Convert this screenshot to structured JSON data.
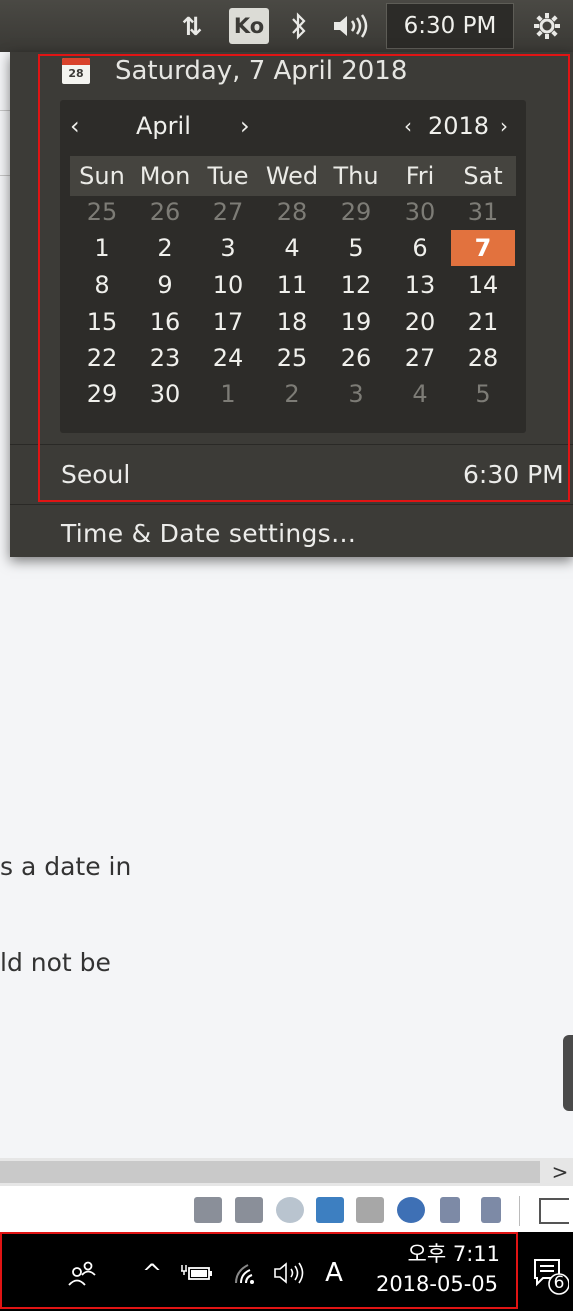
{
  "top_panel": {
    "network_icon": "network-updown-icon",
    "keyboard_lang": "Ko",
    "bluetooth_icon": "bluetooth-icon",
    "volume_icon": "volume-icon",
    "clock": "6:30 PM",
    "settings_icon": "gear-icon"
  },
  "datetime_menu": {
    "calendar_icon_day": "28",
    "header_date": "Saturday, 7 April 2018",
    "month_nav": {
      "prev": "‹",
      "month": "April",
      "next": "›"
    },
    "year_nav": {
      "prev": "‹",
      "year": "2018",
      "next": "›"
    },
    "weekdays": [
      "Sun",
      "Mon",
      "Tue",
      "Wed",
      "Thu",
      "Fri",
      "Sat"
    ],
    "weeks": [
      [
        "25",
        "26",
        "27",
        "28",
        "29",
        "30",
        "31"
      ],
      [
        "1",
        "2",
        "3",
        "4",
        "5",
        "6",
        "7"
      ],
      [
        "8",
        "9",
        "10",
        "11",
        "12",
        "13",
        "14"
      ],
      [
        "15",
        "16",
        "17",
        "18",
        "19",
        "20",
        "21"
      ],
      [
        "22",
        "23",
        "24",
        "25",
        "26",
        "27",
        "28"
      ],
      [
        "29",
        "30",
        "1",
        "2",
        "3",
        "4",
        "5"
      ]
    ],
    "selected_day": "7",
    "location": {
      "name": "Seoul",
      "time": "6:30 PM"
    },
    "settings_label": "Time & Date settings…"
  },
  "document": {
    "line1": "s a date in",
    "line2": "ld not be"
  },
  "scrollbar": {
    "right_arrow": ">"
  },
  "taskbar": {
    "people_icon": "people-icon",
    "show_hidden": "^",
    "battery_icon": "battery-icon",
    "wifi_icon": "wifi-icon",
    "volume_icon": "volume-icon",
    "input_lang": "A",
    "time": "오후 7:11",
    "date": "2018-05-05",
    "notification_count": "6"
  },
  "colors": {
    "panel_bg": "#3c3b37",
    "today_accent": "#e2723e",
    "highlight_box": "#e01414"
  }
}
